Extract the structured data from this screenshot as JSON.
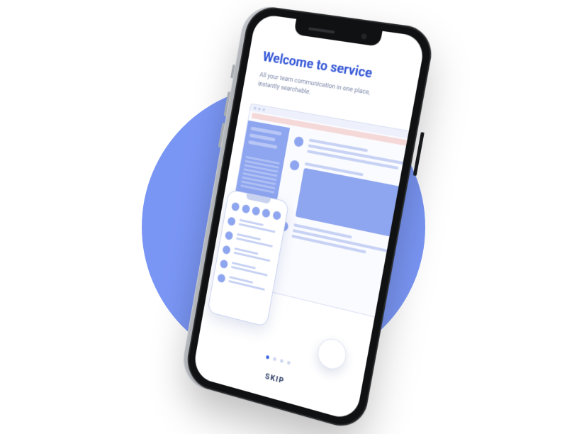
{
  "onboarding": {
    "title": "Welcome to service",
    "subtitle": "All your team communication in one place, instantly searchable.",
    "skip_label": "SKIP",
    "page_count": 4,
    "active_page": 0
  }
}
